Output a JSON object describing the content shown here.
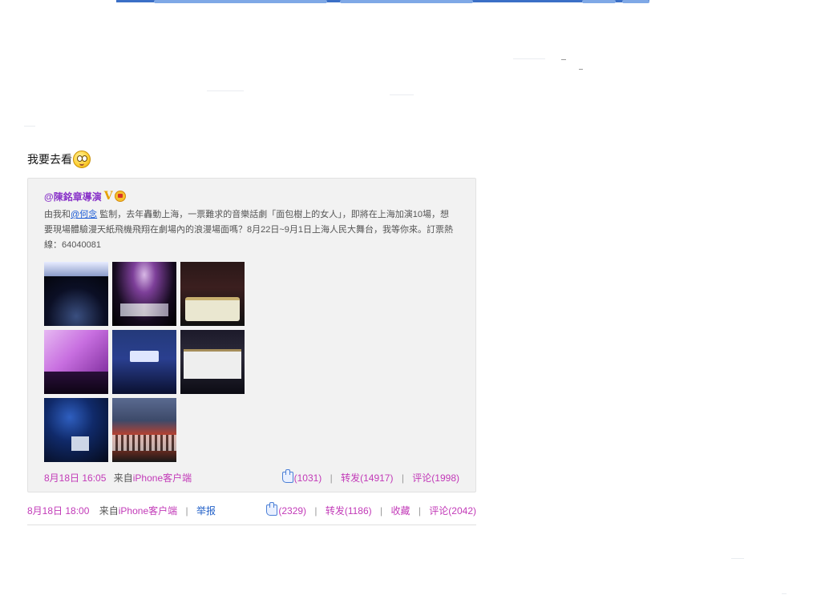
{
  "post": {
    "text": "我要去看",
    "emoticon": "smiley-icon",
    "repost": {
      "author": "@陳銘章導演",
      "badge_v": "V",
      "content_prefix": "由我和",
      "content_mention": "@何念",
      "content_suffix": " 監制，去年轟動上海，一票難求的音樂話劇「面包樹上的女人」，即將在上海加演10場，想要現場體驗漫天紙飛機飛翔在劇場內的浪漫場面嗎？8月22日~9月1日上海人民大舞台，我等你來。訂票熱線：64040081",
      "thumbnails": 8,
      "time": "8月18日 16:05",
      "from_label": "来自",
      "client": "iPhone客户端",
      "likes": "(1031)",
      "repost_label": "转发(14917)",
      "comment_label": "评论(1998)"
    },
    "footer": {
      "time": "8月18日 18:00",
      "from_label": "来自",
      "client": "iPhone客户端",
      "report": "举报",
      "likes": "(2329)",
      "repost_label": "转发(1186)",
      "favorite_label": "收藏",
      "comment_label": "评论(2042)"
    }
  },
  "colors": {
    "accent_purple": "#8a35c9",
    "link_magenta": "#c23ab8",
    "link_blue": "#2361c8",
    "top_bar": "#3b6fc6"
  }
}
